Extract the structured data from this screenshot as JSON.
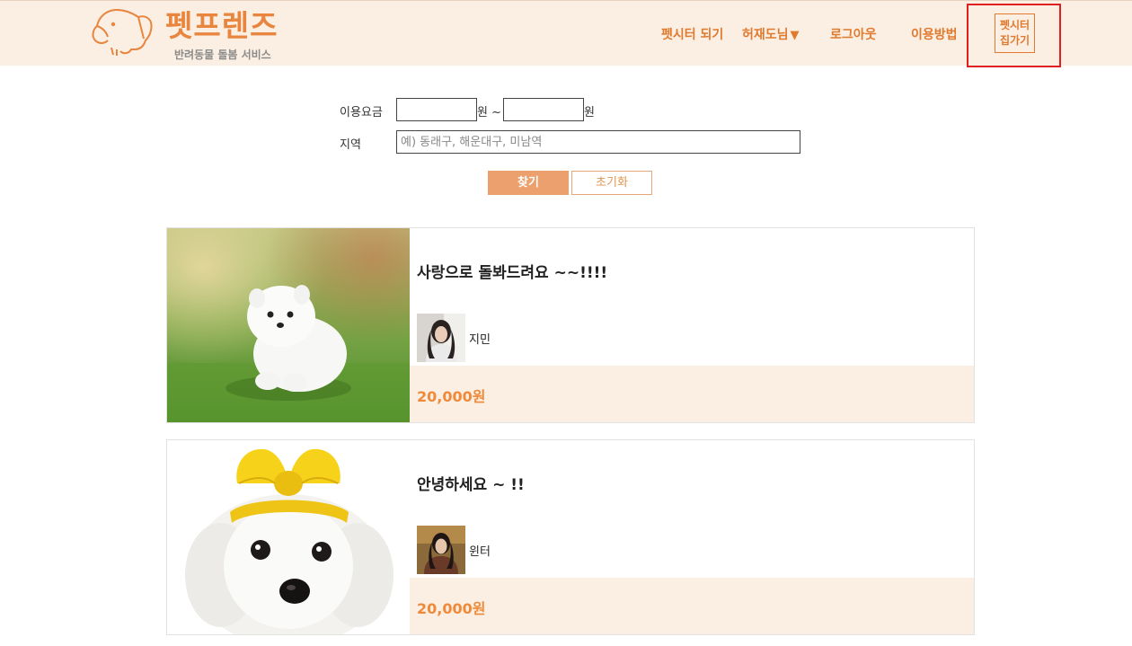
{
  "header": {
    "logo_title": "펫프렌즈",
    "logo_subtitle": "반려동물 돌봄 서비스",
    "nav": {
      "become_sitter": "펫시터 되기",
      "user_menu": "허재도님",
      "user_menu_arrow": "▼",
      "logout": "로그아웃",
      "how_to_use": "이용방법",
      "sitter_home_line1": "펫시터",
      "sitter_home_line2": "집가기"
    }
  },
  "search": {
    "fee_label": "이용요금",
    "min_value": "",
    "max_value": "",
    "unit_min": "원 ~",
    "unit_max": "원",
    "area_label": "지역",
    "area_value": "",
    "area_placeholder": "예) 동래구, 해운대구, 미남역",
    "find_button": "찾기",
    "reset_button": "초기화"
  },
  "listings": [
    {
      "title": "사랑으로 돌봐드려요 ~~!!!!",
      "sitter": "지민",
      "price": "20,000원",
      "photo_icon": "white-pomeranian-on-grass-photo",
      "avatar_icon": "sitter-avatar-photo"
    },
    {
      "title": "안녕하세요 ~ !!",
      "sitter": "윈터",
      "price": "20,000원",
      "photo_icon": "white-maltese-with-yellow-bow-photo",
      "avatar_icon": "sitter-avatar-photo"
    }
  ],
  "colors": {
    "accent": "#e07a2f",
    "header_bg": "#fbeee2",
    "price": "#ef8a3a",
    "find_button": "#eba06e",
    "highlight": "#e02020"
  }
}
